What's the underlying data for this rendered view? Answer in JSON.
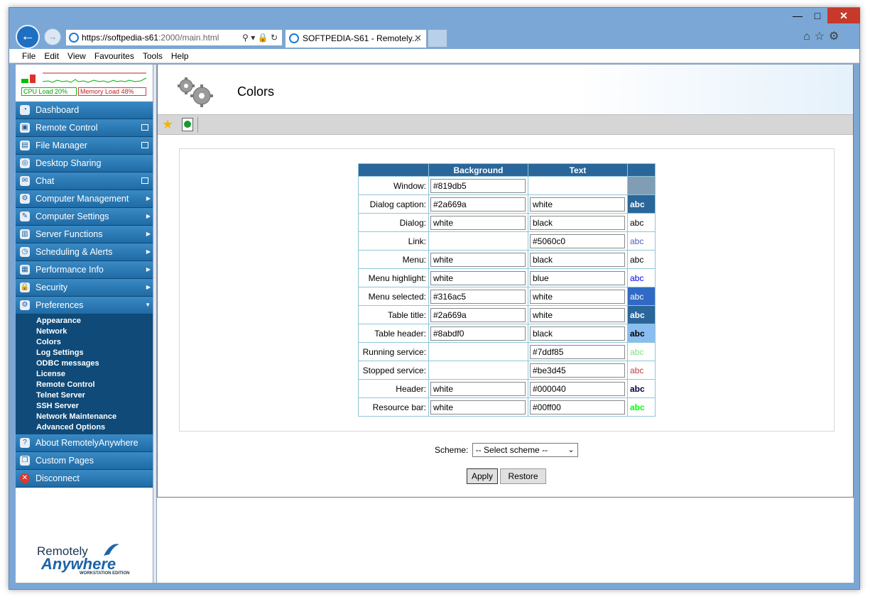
{
  "browser": {
    "url_host": "https://softpedia-s61",
    "url_path": ":2000/main.html",
    "tab_title": "SOFTPEDIA-S61 - Remotely...",
    "tab_close": "✕",
    "menu": [
      "File",
      "Edit",
      "View",
      "Favourites",
      "Tools",
      "Help"
    ]
  },
  "resources": {
    "cpu_label": "CPU Load 20%",
    "memory_label": "Memory Load 48%"
  },
  "sidebar": {
    "items_top": [
      {
        "label": "Dashboard",
        "icon": "dashboard-icon"
      },
      {
        "label": "Remote Control",
        "icon": "remote-control-icon",
        "popup": true
      },
      {
        "label": "File Manager",
        "icon": "file-manager-icon",
        "popup": true
      },
      {
        "label": "Desktop Sharing",
        "icon": "desktop-sharing-icon"
      },
      {
        "label": "Chat",
        "icon": "chat-icon",
        "popup": true
      },
      {
        "label": "Computer Management",
        "icon": "computer-management-icon",
        "arrow": true
      },
      {
        "label": "Computer Settings",
        "icon": "computer-settings-icon",
        "arrow": true
      },
      {
        "label": "Server Functions",
        "icon": "server-functions-icon",
        "arrow": true
      },
      {
        "label": "Scheduling & Alerts",
        "icon": "scheduling-icon",
        "arrow": true
      },
      {
        "label": "Performance Info",
        "icon": "performance-icon",
        "arrow": true
      },
      {
        "label": "Security",
        "icon": "security-icon",
        "arrow": true
      },
      {
        "label": "Preferences",
        "icon": "preferences-icon",
        "expanded": true
      }
    ],
    "sub_items": [
      "Appearance",
      "Network",
      "Colors",
      "Log Settings",
      "ODBC messages",
      "License",
      "Remote Control",
      "Telnet Server",
      "SSH Server",
      "Network Maintenance",
      "Advanced Options"
    ],
    "items_bottom": [
      {
        "label": "About RemotelyAnywhere",
        "icon": "about-icon"
      },
      {
        "label": "Custom Pages",
        "icon": "custom-pages-icon"
      },
      {
        "label": "Disconnect",
        "icon": "disconnect-icon"
      }
    ],
    "logo": {
      "line1": "Remotely",
      "line2": "Anywhere",
      "edition": "WORKSTATION EDITION"
    }
  },
  "page": {
    "title": "Colors"
  },
  "table": {
    "headers": [
      "Background",
      "Text"
    ],
    "rows": [
      {
        "label": "Window:",
        "bg": "#819db5",
        "text": null,
        "swatch_bg": "#819db5",
        "swatch_text": "",
        "swatch_color": "#000000"
      },
      {
        "label": "Dialog caption:",
        "bg": "#2a669a",
        "text": "white",
        "swatch_bg": "#2a669a",
        "swatch_text": "abc",
        "swatch_color": "#ffffff",
        "bold": true
      },
      {
        "label": "Dialog:",
        "bg": "white",
        "text": "black",
        "swatch_bg": "#ffffff",
        "swatch_text": "abc",
        "swatch_color": "#000000"
      },
      {
        "label": "Link:",
        "bg": null,
        "text": "#5060c0",
        "swatch_bg": "#ffffff",
        "swatch_text": "abc",
        "swatch_color": "#5060c0"
      },
      {
        "label": "Menu:",
        "bg": "white",
        "text": "black",
        "swatch_bg": "#ffffff",
        "swatch_text": "abc",
        "swatch_color": "#000000"
      },
      {
        "label": "Menu highlight:",
        "bg": "white",
        "text": "blue",
        "swatch_bg": "#ffffff",
        "swatch_text": "abc",
        "swatch_color": "#0000ff"
      },
      {
        "label": "Menu selected:",
        "bg": "#316ac5",
        "text": "white",
        "swatch_bg": "#316ac5",
        "swatch_text": "abc",
        "swatch_color": "#ffffff"
      },
      {
        "label": "Table title:",
        "bg": "#2a669a",
        "text": "white",
        "swatch_bg": "#2a669a",
        "swatch_text": "abc",
        "swatch_color": "#ffffff",
        "bold": true
      },
      {
        "label": "Table header:",
        "bg": "#8abdf0",
        "text": "black",
        "swatch_bg": "#8abdf0",
        "swatch_text": "abc",
        "swatch_color": "#000000",
        "bold": true
      },
      {
        "label": "Running service:",
        "bg": null,
        "text": "#7ddf85",
        "swatch_bg": "#ffffff",
        "swatch_text": "abc",
        "swatch_color": "#7ddf85"
      },
      {
        "label": "Stopped service:",
        "bg": null,
        "text": "#be3d45",
        "swatch_bg": "#ffffff",
        "swatch_text": "abc",
        "swatch_color": "#be3d45"
      },
      {
        "label": "Header:",
        "bg": "white",
        "text": "#000040",
        "swatch_bg": "#ffffff",
        "swatch_text": "abc",
        "swatch_color": "#000040",
        "bold": true
      },
      {
        "label": "Resource bar:",
        "bg": "white",
        "text": "#00ff00",
        "swatch_bg": "#ffffff",
        "swatch_text": "abc",
        "swatch_color": "#00ff00",
        "bold": true
      }
    ]
  },
  "scheme": {
    "label": "Scheme:",
    "selected": "-- Select scheme --"
  },
  "buttons": {
    "apply": "Apply",
    "restore": "Restore"
  },
  "colors": {
    "menu_blue": "#2a669a",
    "submenu_bg": "#0f4a78",
    "toolbar_gray": "#d6d6d6"
  }
}
